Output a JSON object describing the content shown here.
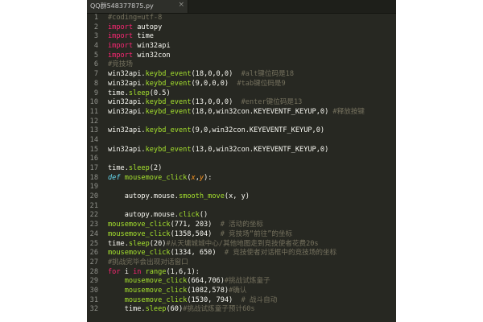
{
  "tab": {
    "title": "QQ群548377875.py",
    "close_glyph": "×",
    "active": true
  },
  "editor": {
    "theme_colors": {
      "background": "#272822",
      "line_number": "#8f908a",
      "plain": "#f8f8f2",
      "comment": "#75715e",
      "keyword": "#f92672",
      "storage": "#66d9ef",
      "function": "#a6e22e",
      "parameter": "#fd971f",
      "number": "#ae81ff"
    },
    "lines": [
      {
        "n": "1",
        "tokens": [
          {
            "t": "#coding=utf-8",
            "c": "com"
          }
        ]
      },
      {
        "n": "2",
        "tokens": [
          {
            "t": "import",
            "c": "key"
          },
          {
            "t": " autopy",
            "c": "pl"
          }
        ]
      },
      {
        "n": "3",
        "tokens": [
          {
            "t": "import",
            "c": "key"
          },
          {
            "t": " time",
            "c": "pl"
          }
        ]
      },
      {
        "n": "4",
        "tokens": [
          {
            "t": "import",
            "c": "key"
          },
          {
            "t": " win32api",
            "c": "pl"
          }
        ]
      },
      {
        "n": "5",
        "tokens": [
          {
            "t": "import",
            "c": "key"
          },
          {
            "t": " win32con",
            "c": "pl"
          }
        ]
      },
      {
        "n": "6",
        "tokens": [
          {
            "t": "#竞技场",
            "c": "com"
          }
        ]
      },
      {
        "n": "7",
        "tokens": [
          {
            "t": "win32api.",
            "c": "pl"
          },
          {
            "t": "keybd_event",
            "c": "fn"
          },
          {
            "t": "(18,0,0,0)  ",
            "c": "pl"
          },
          {
            "t": "#alt键位码是18",
            "c": "com"
          }
        ]
      },
      {
        "n": "8",
        "tokens": [
          {
            "t": "win32api.",
            "c": "pl"
          },
          {
            "t": "keybd_event",
            "c": "fn"
          },
          {
            "t": "(9,0,0,0)  ",
            "c": "pl"
          },
          {
            "t": "#tab键位码是9",
            "c": "com"
          }
        ]
      },
      {
        "n": "9",
        "tokens": [
          {
            "t": "time.",
            "c": "pl"
          },
          {
            "t": "sleep",
            "c": "fn"
          },
          {
            "t": "(0.5)",
            "c": "pl"
          }
        ]
      },
      {
        "n": "10",
        "tokens": [
          {
            "t": "win32api.",
            "c": "pl"
          },
          {
            "t": "keybd_event",
            "c": "fn"
          },
          {
            "t": "(13,0,0,0)  ",
            "c": "pl"
          },
          {
            "t": "#enter键位码是13",
            "c": "com"
          }
        ]
      },
      {
        "n": "11",
        "tokens": [
          {
            "t": "win32api.",
            "c": "pl"
          },
          {
            "t": "keybd_event",
            "c": "fn"
          },
          {
            "t": "(18,0,win32con.KEYEVENTF_KEYUP,0) ",
            "c": "pl"
          },
          {
            "t": "#释放按键",
            "c": "com"
          }
        ]
      },
      {
        "n": "12",
        "tokens": []
      },
      {
        "n": "13",
        "tokens": [
          {
            "t": "win32api.",
            "c": "pl"
          },
          {
            "t": "keybd_event",
            "c": "fn"
          },
          {
            "t": "(9,0,win32con.KEYEVENTF_KEYUP,0)",
            "c": "pl"
          }
        ]
      },
      {
        "n": "14",
        "tokens": []
      },
      {
        "n": "15",
        "tokens": [
          {
            "t": "win32api.",
            "c": "pl"
          },
          {
            "t": "keybd_event",
            "c": "fn"
          },
          {
            "t": "(13,0,win32con.KEYEVENTF_KEYUP,0)",
            "c": "pl"
          }
        ]
      },
      {
        "n": "16",
        "tokens": []
      },
      {
        "n": "17",
        "tokens": [
          {
            "t": "time.",
            "c": "pl"
          },
          {
            "t": "sleep",
            "c": "fn"
          },
          {
            "t": "(2)",
            "c": "pl"
          }
        ]
      },
      {
        "n": "18",
        "tokens": [
          {
            "t": "def",
            "c": "def"
          },
          {
            "t": " ",
            "c": "pl"
          },
          {
            "t": "mousemove_click",
            "c": "fn"
          },
          {
            "t": "(",
            "c": "pl"
          },
          {
            "t": "x",
            "c": "arg"
          },
          {
            "t": ",",
            "c": "pl"
          },
          {
            "t": "y",
            "c": "arg"
          },
          {
            "t": "):",
            "c": "pl"
          }
        ]
      },
      {
        "n": "19",
        "tokens": []
      },
      {
        "n": "20",
        "tokens": [
          {
            "t": "    autopy.mouse.",
            "c": "pl"
          },
          {
            "t": "smooth_move",
            "c": "fn"
          },
          {
            "t": "(x, y)",
            "c": "pl"
          }
        ]
      },
      {
        "n": "21",
        "tokens": []
      },
      {
        "n": "22",
        "tokens": [
          {
            "t": "    autopy.mouse.",
            "c": "pl"
          },
          {
            "t": "click",
            "c": "fn"
          },
          {
            "t": "()",
            "c": "pl"
          }
        ]
      },
      {
        "n": "23",
        "tokens": [
          {
            "t": "mousemove_click",
            "c": "fn"
          },
          {
            "t": "(771, 203)  ",
            "c": "pl"
          },
          {
            "t": "# 活动的坐标",
            "c": "com"
          }
        ]
      },
      {
        "n": "24",
        "tokens": [
          {
            "t": "mousemove_click",
            "c": "fn"
          },
          {
            "t": "(1358,504)  ",
            "c": "pl"
          },
          {
            "t": "# 竞技场“前往”的坐标",
            "c": "com"
          }
        ]
      },
      {
        "n": "25",
        "tokens": [
          {
            "t": "time.",
            "c": "pl"
          },
          {
            "t": "sleep",
            "c": "fn"
          },
          {
            "t": "(20)",
            "c": "pl"
          },
          {
            "t": "#从天墉城城中心/其他地图走到竞技使者花费20s",
            "c": "com"
          }
        ]
      },
      {
        "n": "26",
        "tokens": [
          {
            "t": "mousemove_click",
            "c": "fn"
          },
          {
            "t": "(1334, 650)  ",
            "c": "pl"
          },
          {
            "t": "# 竞技使者对话框中的竞技场的坐标",
            "c": "com"
          }
        ]
      },
      {
        "n": "27",
        "tokens": [
          {
            "t": "#挑战完毕会出现对话窗口",
            "c": "com"
          }
        ]
      },
      {
        "n": "28",
        "tokens": [
          {
            "t": "for",
            "c": "key"
          },
          {
            "t": " i ",
            "c": "pl"
          },
          {
            "t": "in",
            "c": "key"
          },
          {
            "t": " ",
            "c": "pl"
          },
          {
            "t": "range",
            "c": "fn"
          },
          {
            "t": "(1,6,1):",
            "c": "pl"
          }
        ]
      },
      {
        "n": "29",
        "tokens": [
          {
            "t": "    ",
            "c": "pl"
          },
          {
            "t": "mousemove_click",
            "c": "fn"
          },
          {
            "t": "(664,706)",
            "c": "pl"
          },
          {
            "t": "#挑战试炼童子",
            "c": "com"
          }
        ]
      },
      {
        "n": "30",
        "tokens": [
          {
            "t": "    ",
            "c": "pl"
          },
          {
            "t": "mousemove_click",
            "c": "fn"
          },
          {
            "t": "(1082,578)",
            "c": "pl"
          },
          {
            "t": "#确认",
            "c": "com"
          }
        ]
      },
      {
        "n": "31",
        "tokens": [
          {
            "t": "    ",
            "c": "pl"
          },
          {
            "t": "mousemove_click",
            "c": "fn"
          },
          {
            "t": "(1530, 794)  ",
            "c": "pl"
          },
          {
            "t": "# 战斗自动",
            "c": "com"
          }
        ]
      },
      {
        "n": "32",
        "tokens": [
          {
            "t": "    time.",
            "c": "pl"
          },
          {
            "t": "sleep",
            "c": "fn"
          },
          {
            "t": "(60)",
            "c": "pl"
          },
          {
            "t": "#挑战试炼童子预计60s",
            "c": "com"
          }
        ]
      }
    ]
  }
}
